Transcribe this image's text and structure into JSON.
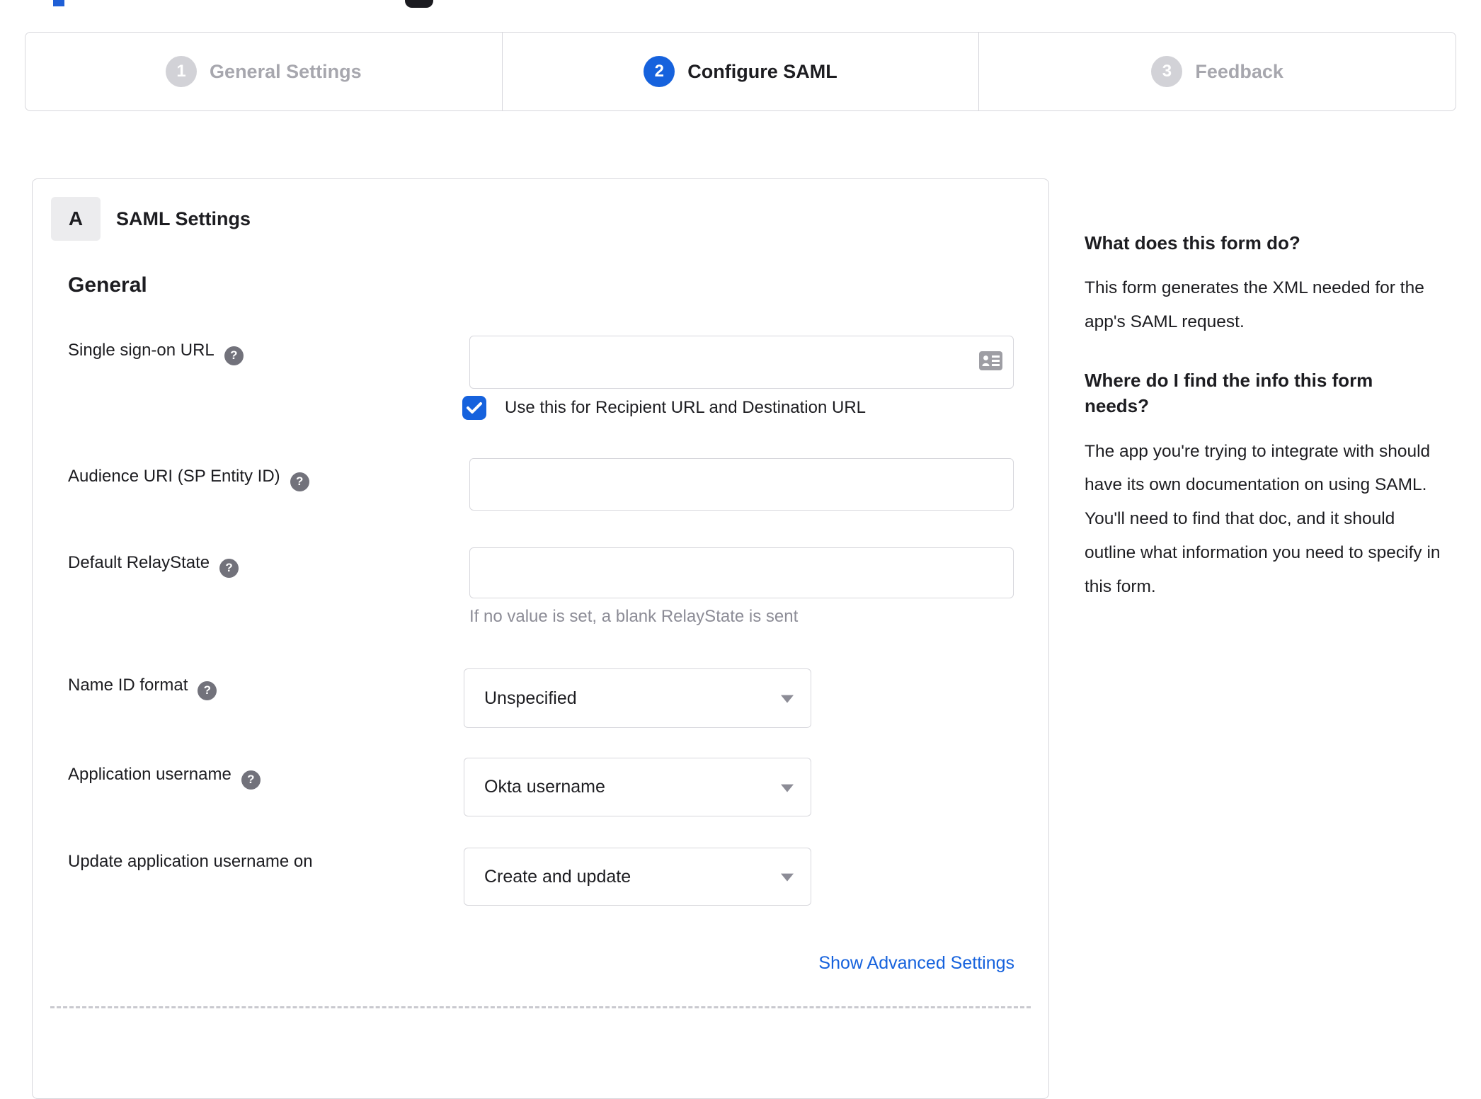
{
  "stepper": {
    "steps": [
      {
        "number": "1",
        "label": "General Settings",
        "state": "inactive"
      },
      {
        "number": "2",
        "label": "Configure SAML",
        "state": "active"
      },
      {
        "number": "3",
        "label": "Feedback",
        "state": "inactive"
      }
    ]
  },
  "card": {
    "section_badge": "A",
    "section_title": "SAML Settings",
    "group_heading": "General",
    "fields": [
      {
        "label": "Single sign-on URL",
        "has_help": true,
        "value": "",
        "icon": "contact-card-icon",
        "checkbox": {
          "checked": true,
          "label": "Use this for Recipient URL and Destination URL"
        }
      },
      {
        "label": "Audience URI (SP Entity ID)",
        "has_help": true,
        "value": ""
      },
      {
        "label": "Default RelayState",
        "has_help": true,
        "value": "",
        "hint": "If no value is set, a blank RelayState is sent"
      },
      {
        "label": "Name ID format",
        "has_help": true,
        "value": "Unspecified",
        "control": "select"
      },
      {
        "label": "Application username",
        "has_help": true,
        "value": "Okta username",
        "control": "select"
      },
      {
        "label": "Update application username on",
        "has_help": false,
        "value": "Create and update",
        "control": "select"
      }
    ],
    "advanced_link": "Show Advanced Settings",
    "help_glyph": "?"
  },
  "help_panel": {
    "heading1": "What does this form do?",
    "para1": "This form generates the XML needed for the app's SAML request.",
    "heading2": "Where do I find the info this form needs?",
    "para2": "The app you're trying to integrate with should have its own documentation on using SAML. You'll need to find that doc, and it should outline what information you need to specify in this form."
  },
  "colors": {
    "accent_blue": "#1662dd",
    "border_gray": "#d7d7dc",
    "text_dark": "#1d1d21",
    "text_gray": "#8c8c96",
    "inactive_step_gray": "#d2d2d7"
  }
}
